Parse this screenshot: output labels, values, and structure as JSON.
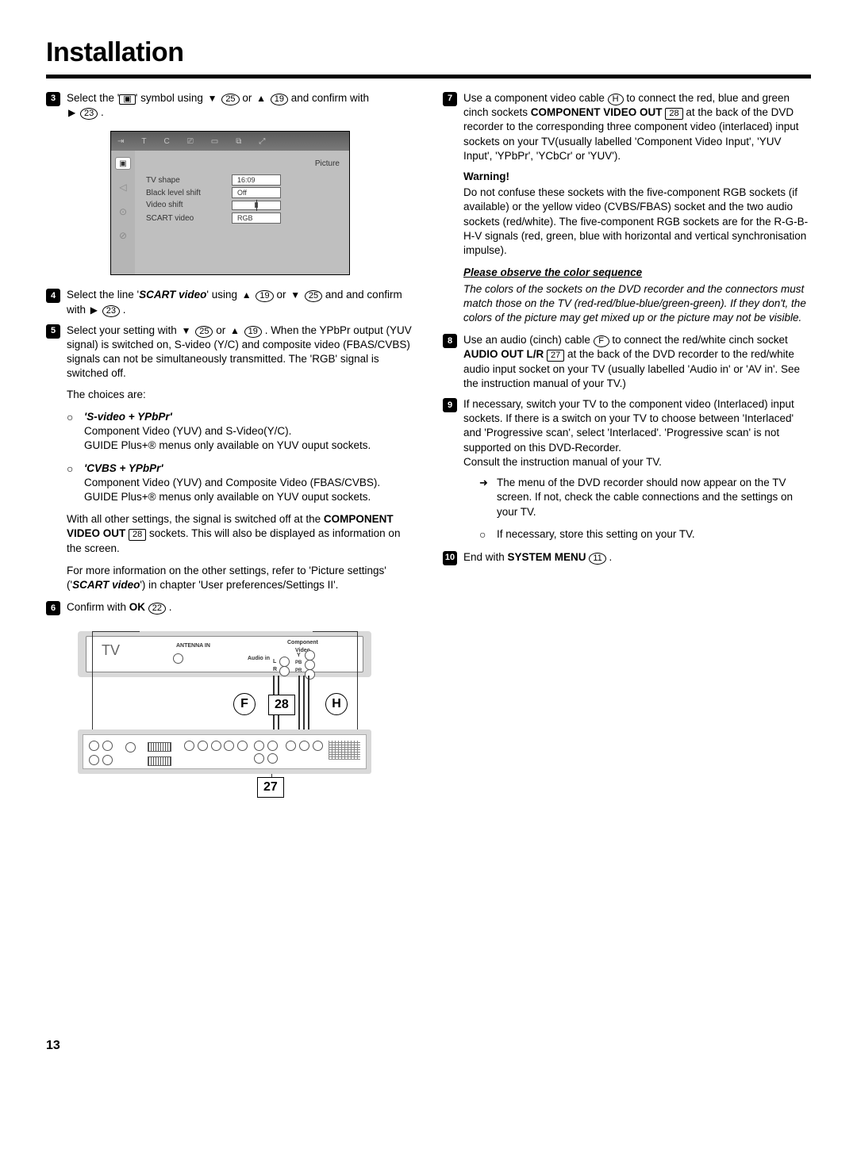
{
  "title": "Installation",
  "page_number": "13",
  "menu": {
    "caption": "Picture",
    "rows": {
      "tv_shape": {
        "label": "TV shape",
        "value": "16:09"
      },
      "black_level": {
        "label": "Black level shift",
        "value": "Off"
      },
      "video_shift": {
        "label": "Video shift"
      },
      "scart_video": {
        "label": "SCART video",
        "value": "RGB"
      }
    }
  },
  "steps": {
    "s3_a": "Select the '",
    "s3_b": "' symbol using ",
    "s3_c": " and confirm with ",
    "s4_a": "Select the line '",
    "s4_scart": "SCART video",
    "s4_b": "' using ",
    "s4_c": " and confirm with ",
    "s5_a": "Select your setting with ",
    "s5_b": " . When the YPbPr output (YUV signal) is switched on, S-video (Y/C) and composite video (FBAS/CVBS) signals can not be simultaneously transmitted. The 'RGB' signal is switched off.",
    "choices_intro": "The choices are:",
    "choice1_head": "'S-video + YPbPr'",
    "choice1_l1": "Component Video (YUV) and S-Video(Y/C).",
    "choice1_l2": "GUIDE Plus+® menus only available on YUV ouput sockets.",
    "choice2_head": "'CVBS + YPbPr'",
    "choice2_l1": "Component Video (YUV) and Composite Video (FBAS/CVBS).",
    "choice2_l2": "GUIDE Plus+® menus only available on YUV ouput sockets.",
    "after_choices_1a": "With all other settings, the signal is switched off at the ",
    "after_choices_1_bold": "COMPONENT VIDEO OUT",
    "after_choices_1b": " sockets. This will also be displayed as information on the screen.",
    "after_choices_2a": "For more information on the other settings, refer to 'Picture settings' ('",
    "after_choices_2_scart": "SCART video",
    "after_choices_2b": "') in chapter 'User preferences/Settings II'.",
    "s6_a": "Confirm with ",
    "s6_ok": "OK",
    "s7_a": "Use a component video cable ",
    "s7_b": " to connect the red, blue and green cinch sockets ",
    "s7_bold": "COMPONENT VIDEO OUT",
    "s7_c": " at the back of the DVD recorder to the corresponding three component video (interlaced) input sockets on your TV(usually labelled 'Component Video Input', 'YUV Input', 'YPbPr', 'YCbCr' or 'YUV').",
    "warn_head": "Warning!",
    "warn_body": "Do not confuse these sockets with the five-component RGB sockets (if available) or the yellow video (CVBS/FBAS) socket and the two audio sockets (red/white). The five-component RGB sockets are for the R-G-B-H-V signals (red, green, blue with horizontal and vertical synchronisation impulse).",
    "obs_head": "Please observe the color sequence",
    "obs_body": "The colors of the sockets on the DVD recorder and the connectors must match those on the TV (red-red/blue-blue/green-green). If they don't, the colors of the picture may get mixed up or the picture may not be visible.",
    "s8_a": "Use an audio (cinch) cable ",
    "s8_b": " to connect the red/white cinch socket ",
    "s8_bold": "AUDIO OUT L/R",
    "s8_c": " at the back of the DVD recorder to the red/white audio input socket on your TV (usually labelled 'Audio in' or 'AV in'. See the instruction manual of your TV.)",
    "s9_a": "If necessary, switch your TV to the component video (Interlaced) input sockets. If there is a switch on your TV to choose between 'Interlaced' and 'Progressive scan', select 'Interlaced'. 'Progressive scan' is not supported on this DVD-Recorder.",
    "s9_b": "Consult the instruction manual of your TV.",
    "s9_sub1": "The menu of the DVD recorder should now appear on the TV screen. If not, check the cable connections and the settings on your TV.",
    "s9_sub2": "If necessary, store this setting on your TV.",
    "s10_a": "End with ",
    "s10_bold": "SYSTEM MENU"
  },
  "refs": {
    "r11": "11",
    "r19": "19",
    "r22": "22",
    "r23": "23",
    "r25": "25",
    "r27": "27",
    "r28": "28",
    "F": "F",
    "H": "H"
  },
  "diagram": {
    "tv": "TV",
    "antenna": "ANTENNA IN",
    "component": "Component\nVideo",
    "audioin": "Audio in",
    "L": "L",
    "R": "R",
    "Y": "Y",
    "PB": "PB",
    "PR": "PR",
    "b28": "28",
    "b27": "27",
    "cF": "F",
    "cH": "H"
  },
  "words": {
    "or": " or ",
    "and": " and ",
    "period": " ."
  }
}
